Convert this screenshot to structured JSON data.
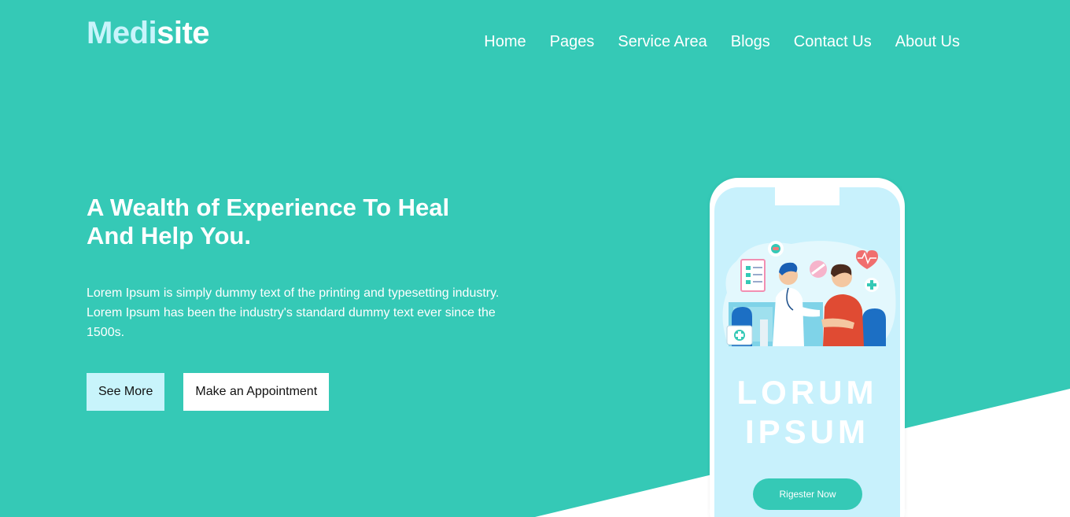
{
  "brand": {
    "part1": "Medi",
    "part2": "site"
  },
  "nav": {
    "items": [
      {
        "label": "Home"
      },
      {
        "label": "Pages"
      },
      {
        "label": "Service Area"
      },
      {
        "label": "Blogs"
      },
      {
        "label": "Contact Us"
      },
      {
        "label": "About Us"
      }
    ]
  },
  "hero": {
    "title": "A Wealth of Experience To Heal And Help You.",
    "description": "Lorem Ipsum is simply dummy text of the printing and typesetting industry. Lorem Ipsum has been the industry's standard dummy text ever since the 1500s.",
    "see_more_label": "See More",
    "appointment_label": "Make an Appointment"
  },
  "phone": {
    "promo_line1": "LORUM",
    "promo_line2": "IPSUM",
    "register_label": "Rigester Now",
    "illustration": "doctor-examining-patient-illustration"
  },
  "colors": {
    "primary": "#35c9b6",
    "accent_light": "#c8f4fb",
    "white": "#ffffff"
  }
}
